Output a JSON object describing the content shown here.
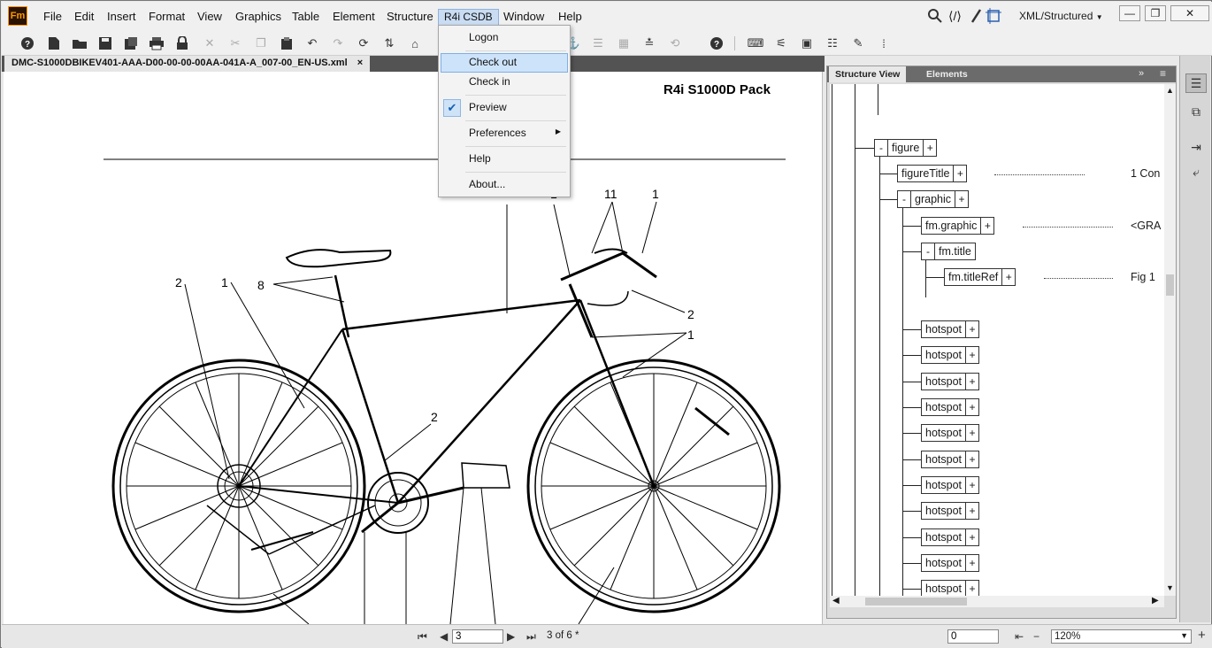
{
  "app": {
    "logo": "Fm"
  },
  "menubar": {
    "items": [
      "File",
      "Edit",
      "Insert",
      "Format",
      "View",
      "Graphics",
      "Table",
      "Element",
      "Structure",
      "R4i CSDB",
      "Window",
      "Help"
    ],
    "workspace": "XML/Structured"
  },
  "tab": {
    "title": "DMC-S1000DBIKEV401-AAA-D00-00-00-00AA-041A-A_007-00_EN-US.xml",
    "close": "×"
  },
  "document": {
    "header": "R4i S1000D Pack",
    "callouts": [
      "11",
      "1",
      "2",
      "1",
      "8",
      "2",
      "1",
      "2",
      "1"
    ]
  },
  "dropdown": {
    "items": [
      "Logon",
      "Check out",
      "Check in",
      "Preview",
      "Preferences",
      "Help",
      "About..."
    ],
    "highlighted": "Check out",
    "checked": "Preview"
  },
  "panel": {
    "tabs": [
      "Structure View",
      "Elements"
    ],
    "nodes": {
      "figure": "figure",
      "figureTitle": "figureTitle",
      "graphic": "graphic",
      "fm_graphic": "fm.graphic",
      "fm_title": "fm.title",
      "fm_titleRef": "fm.titleRef",
      "hotspot": "hotspot"
    },
    "texts": {
      "figureTitle": "1 Con",
      "fm_graphic": "<GRA",
      "fm_titleRef": "Fig 1"
    },
    "minus": "-",
    "plus": "+"
  },
  "status": {
    "page_input": "3",
    "page_label": "3 of 6 *",
    "value_input": "0",
    "zoom": "120%"
  }
}
